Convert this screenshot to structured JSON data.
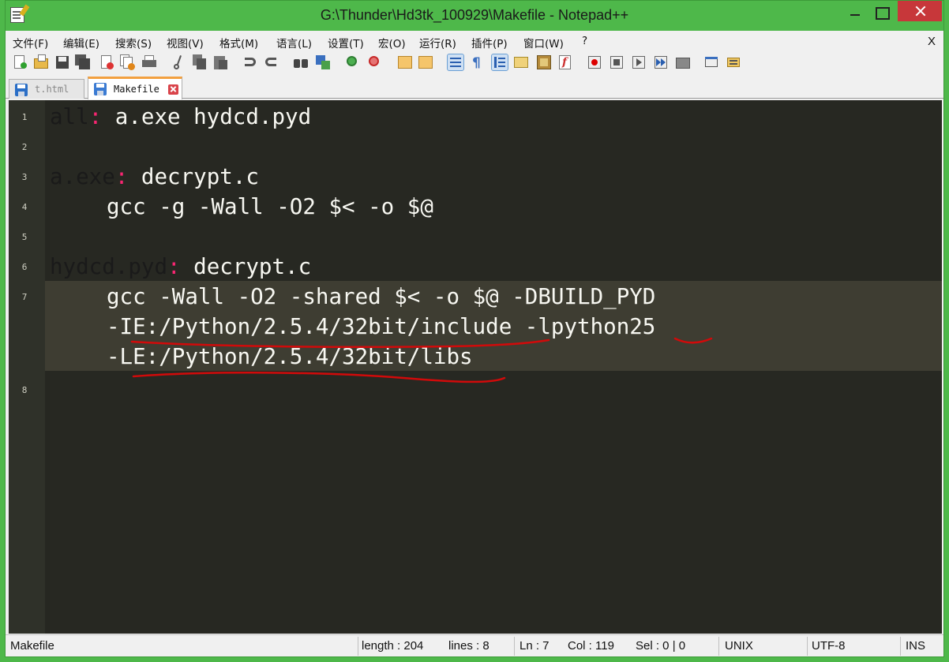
{
  "window": {
    "title": "G:\\Thunder\\Hd3tk_100929\\Makefile - Notepad++"
  },
  "menu": {
    "items": [
      "文件(F)",
      "编辑(E)",
      "搜索(S)",
      "视图(V)",
      "格式(M)",
      "语言(L)",
      "设置(T)",
      "宏(O)",
      "运行(R)",
      "插件(P)",
      "窗口(W)",
      "?"
    ],
    "close_label": "X"
  },
  "toolbar": {
    "icons": [
      "new-file-icon",
      "open-file-icon",
      "save-icon",
      "save-all-icon",
      "close-icon",
      "close-all-icon",
      "print-icon",
      "cut-icon",
      "copy-icon",
      "paste-icon",
      "undo-icon",
      "redo-icon",
      "find-icon",
      "replace-icon",
      "zoom-in-icon",
      "zoom-out-icon",
      "sync-vertical-icon",
      "sync-horizontal-icon",
      "word-wrap-icon",
      "show-all-chars-icon",
      "indent-guide-icon",
      "user-lang-icon",
      "doc-map-icon",
      "function-list-icon",
      "record-macro-icon",
      "stop-macro-icon",
      "play-macro-icon",
      "run-macro-multiple-icon",
      "save-macro-icon",
      "console-icon",
      "monitoring-icon"
    ]
  },
  "tabs": [
    {
      "label": "t.html",
      "active": false
    },
    {
      "label": "Makefile",
      "active": true
    }
  ],
  "editor": {
    "lines": [
      {
        "n": "1",
        "target": "all",
        "colon": ":",
        "rest": " a.exe hydcd.pyd"
      },
      {
        "n": "2"
      },
      {
        "n": "3",
        "target": "a.exe",
        "colon": ":",
        "rest": " decrypt.c"
      },
      {
        "n": "4",
        "cmd": "gcc -g -Wall -O2 $< -o $@"
      },
      {
        "n": "5"
      },
      {
        "n": "6",
        "target": "hydcd.pyd",
        "colon": ":",
        "rest": " decrypt.c"
      },
      {
        "n": "7",
        "cmd": "gcc -Wall -O2 -shared $< -o $@ -DBUILD_PYD"
      },
      {
        "cmd": "-IE:/Python/2.5.4/32bit/include -lpython25"
      },
      {
        "cmd": "-LE:/Python/2.5.4/32bit/libs"
      },
      {
        "n": "8"
      }
    ],
    "annotation_color": "#d10a0a"
  },
  "status": {
    "file_type": "Makefile",
    "length": "length : 204",
    "lines": "lines : 8",
    "ln": "Ln : 7",
    "col": "Col : 119",
    "sel": "Sel : 0 | 0",
    "eol": "UNIX",
    "encoding": "UTF-8",
    "mode": "INS"
  },
  "colors": {
    "accent": "#4eb84a",
    "editor_bg": "#272822",
    "keyword": "#f92672"
  }
}
